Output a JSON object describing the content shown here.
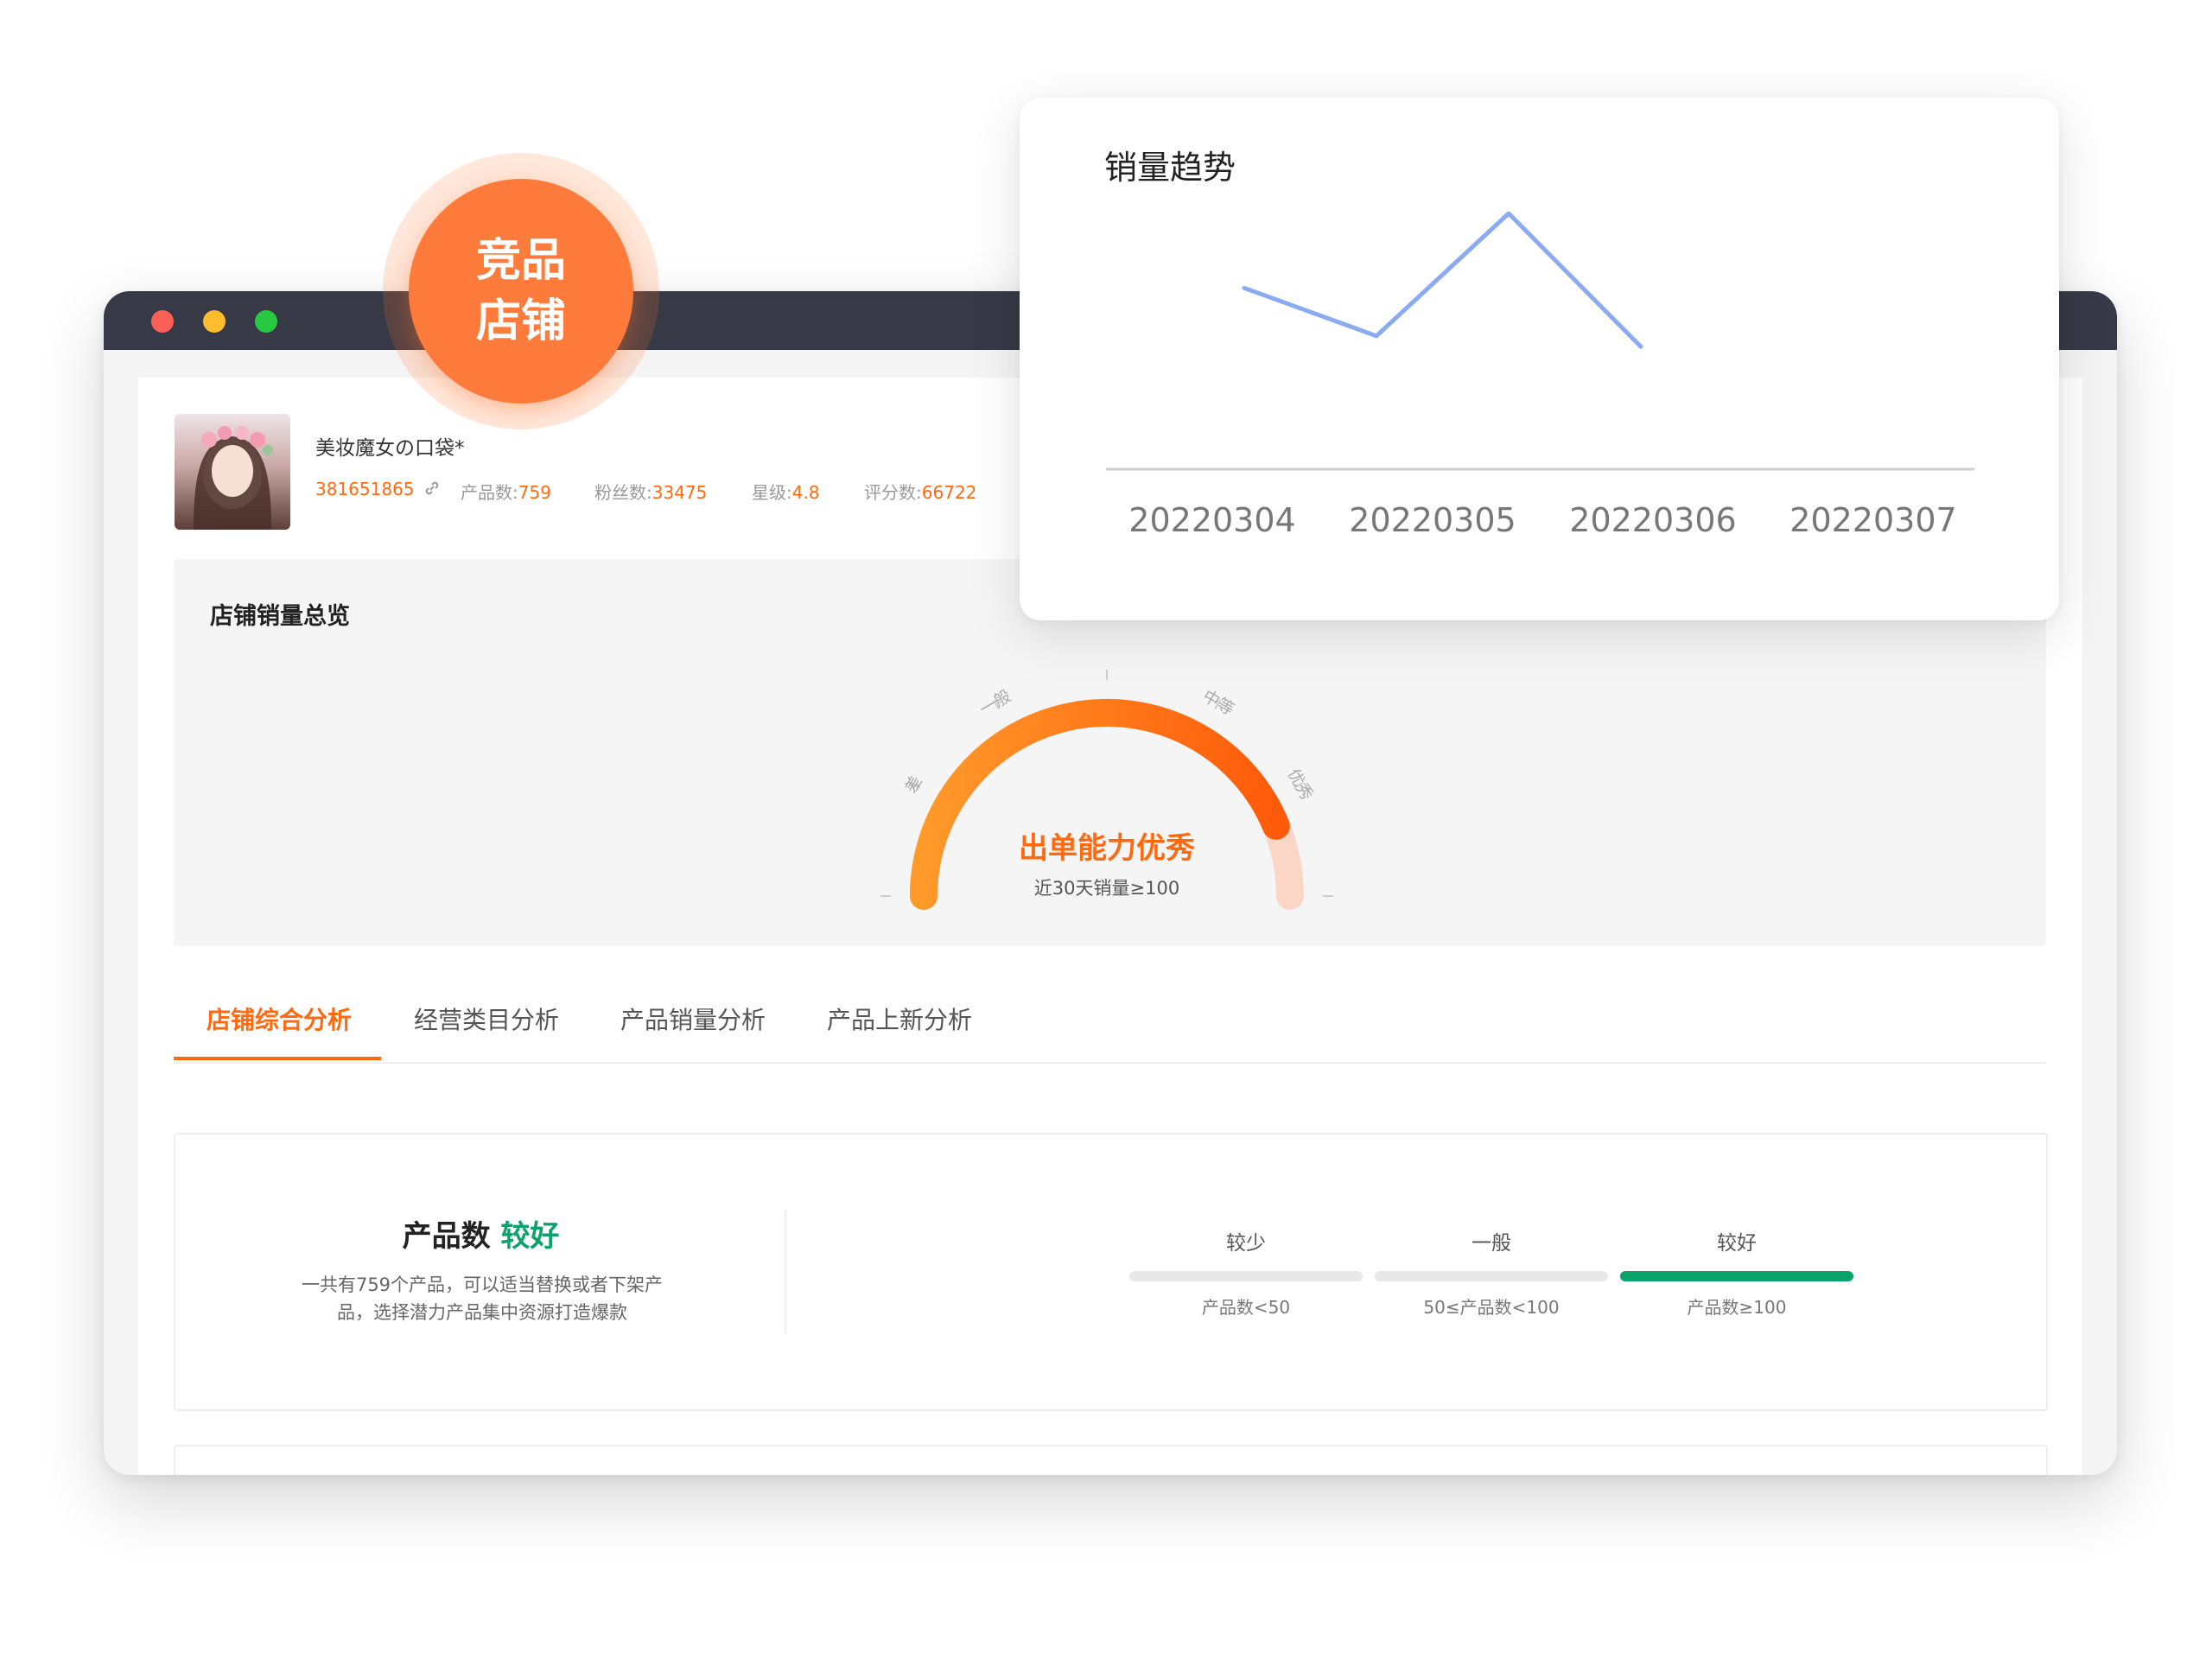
{
  "window": {
    "controls": [
      "close",
      "minimize",
      "zoom"
    ],
    "colors": {
      "titlebar": "#373946",
      "close": "#fe5f57",
      "minimize": "#fdbc2e",
      "zoom": "#28c840"
    }
  },
  "badge": {
    "line1": "竞品",
    "line2": "店铺",
    "color": "#ff7b3b"
  },
  "shop": {
    "name": "美妆魔女の口袋*",
    "id": "381651865",
    "stats": [
      {
        "label": "产品数:",
        "value": "759"
      },
      {
        "label": "粉丝数:",
        "value": "33475"
      },
      {
        "label": "星级:",
        "value": "4.8"
      },
      {
        "label": "评分数:",
        "value": "66722"
      }
    ],
    "accent_color": "#ff6a10"
  },
  "overview": {
    "title": "店铺销量总览",
    "gauge": {
      "level_labels": [
        "差",
        "一般",
        "中等",
        "优秀"
      ],
      "level": 0.875,
      "status": "出单能力优秀",
      "sub": "近30天销量≥100"
    }
  },
  "tabs": [
    {
      "label": "店铺综合分析",
      "active": true
    },
    {
      "label": "经营类目分析",
      "active": false
    },
    {
      "label": "产品销量分析",
      "active": false
    },
    {
      "label": "产品上新分析",
      "active": false
    }
  ],
  "metric": {
    "name": "产品数",
    "rating": "较好",
    "desc_line1": "一共有759个产品，可以适当替换或者下架产",
    "desc_line2": "品，选择潜力产品集中资源打造爆款",
    "levels": [
      {
        "label": "较少",
        "range": "产品数<50",
        "active": false
      },
      {
        "label": "一般",
        "range": "50≤产品数<100",
        "active": false
      },
      {
        "label": "较好",
        "range": "产品数≥100",
        "active": true
      }
    ],
    "good_color": "#0aa36b"
  },
  "chart_data": {
    "type": "line",
    "title": "销量趋势",
    "categories": [
      "20220304",
      "20220305",
      "20220306",
      "20220307"
    ],
    "series": [
      {
        "values": [
          3.4,
          2.5,
          4.8,
          2.3
        ]
      }
    ],
    "ylim": [
      0,
      6
    ],
    "grid": false,
    "color": "#8aaaf2"
  }
}
